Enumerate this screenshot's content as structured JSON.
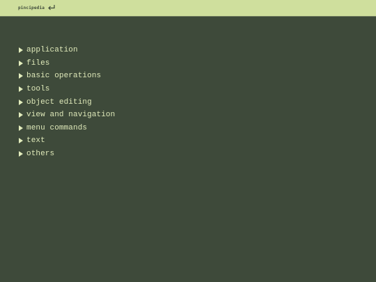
{
  "header": {
    "brand": "pincipedia",
    "back_icon": "return-arrow-icon"
  },
  "menu": {
    "items": [
      {
        "label": "application"
      },
      {
        "label": "files"
      },
      {
        "label": "basic operations"
      },
      {
        "label": "tools"
      },
      {
        "label": "object editing"
      },
      {
        "label": "view and navigation"
      },
      {
        "label": "menu commands"
      },
      {
        "label": "text"
      },
      {
        "label": "others"
      }
    ],
    "expand_icon": "triangle-right-icon"
  },
  "colors": {
    "background": "#3e4a3a",
    "topbar": "#cfdf9d",
    "text": "#dfe9b9"
  }
}
